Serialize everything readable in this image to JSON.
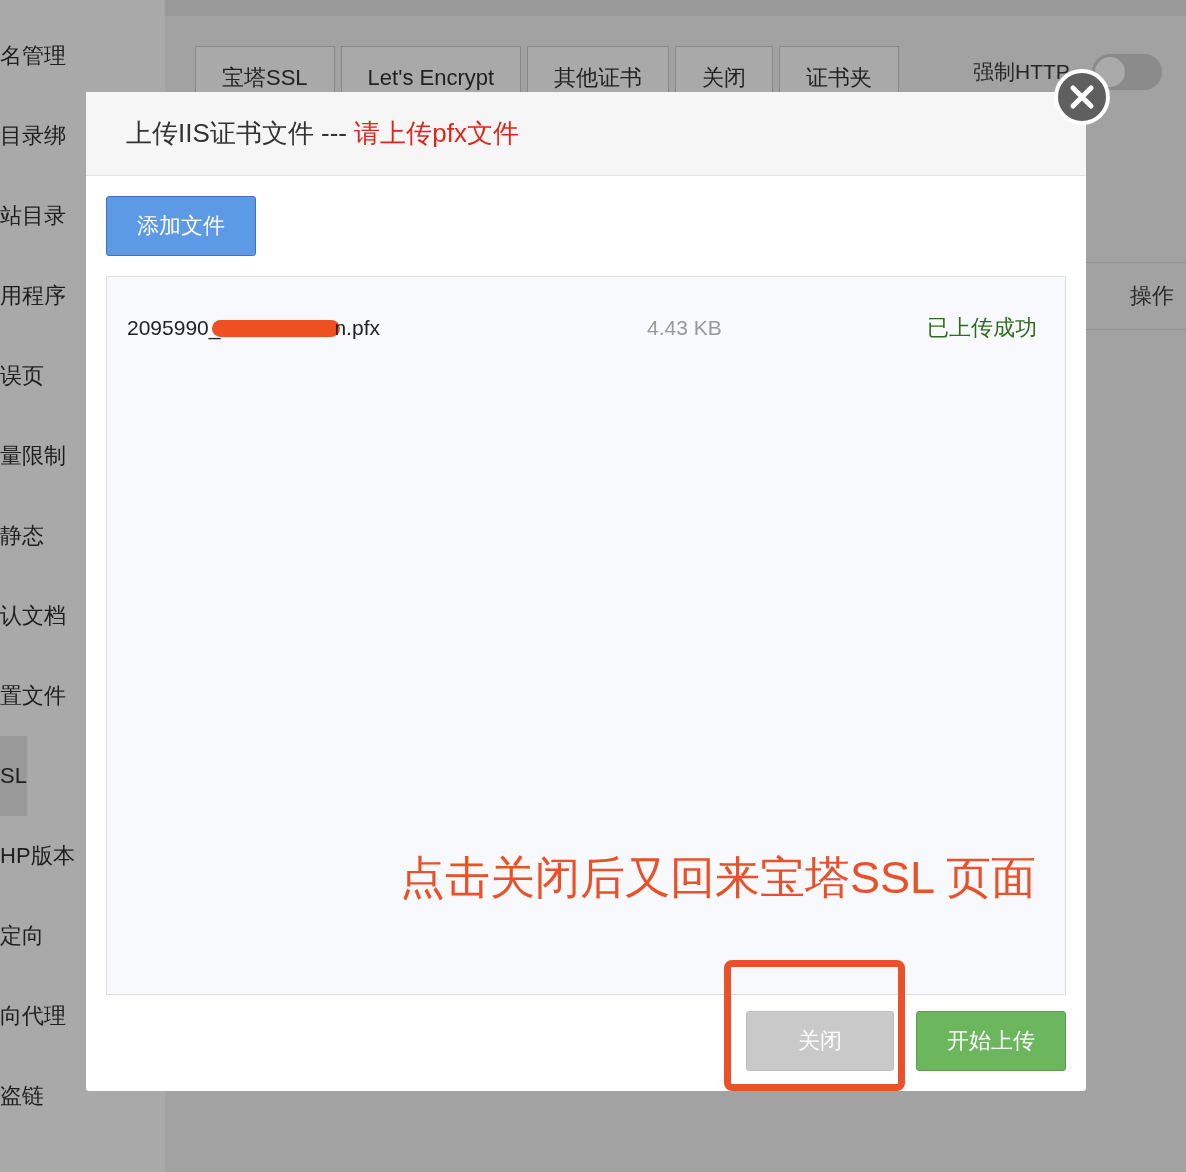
{
  "sidebar": {
    "items": [
      {
        "label": "名管理",
        "selected": false
      },
      {
        "label": "目录绑",
        "selected": false
      },
      {
        "label": "站目录",
        "selected": false
      },
      {
        "label": "用程序",
        "selected": false
      },
      {
        "label": "误页",
        "selected": false
      },
      {
        "label": "量限制",
        "selected": false
      },
      {
        "label": "静态",
        "selected": false
      },
      {
        "label": "认文档",
        "selected": false
      },
      {
        "label": "置文件",
        "selected": false
      },
      {
        "label": "SL",
        "selected": true
      },
      {
        "label": "HP版本",
        "selected": false
      },
      {
        "label": "定向",
        "selected": false
      },
      {
        "label": "向代理",
        "selected": false
      },
      {
        "label": "盗链",
        "selected": false
      }
    ]
  },
  "tabs": [
    {
      "label": "宝塔SSL"
    },
    {
      "label": "Let's Encrypt"
    },
    {
      "label": "其他证书"
    },
    {
      "label": "关闭"
    },
    {
      "label": "证书夹"
    }
  ],
  "force_https": {
    "label": "强制HTTP",
    "on": false
  },
  "table": {
    "columns": [
      "操作"
    ]
  },
  "dialog": {
    "title": "上传IIS证书文件 --- ",
    "title_hint": "请上传pfx文件",
    "add_button": "添加文件",
    "files": [
      {
        "name_start": "2095990_",
        "name_end": "n.pfx",
        "redacted": true,
        "size": "4.43 KB",
        "status": "已上传成功"
      }
    ],
    "buttons": [
      {
        "label": "关闭",
        "kind": "secondary"
      },
      {
        "label": "开始上传",
        "kind": "primary"
      }
    ]
  },
  "annotation": {
    "text": "点击关闭后又回来宝塔SSL 页面"
  }
}
